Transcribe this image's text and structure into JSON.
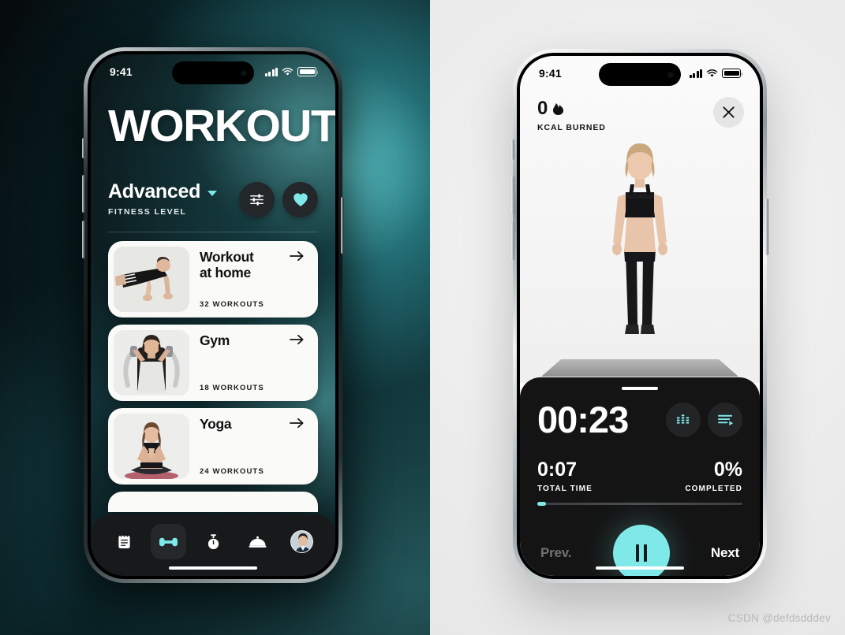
{
  "watermark": "CSDN @defdsdddev",
  "left_phone": {
    "status_bar": {
      "time": "9:41",
      "cellular_icon": "cellular-bars-icon",
      "wifi_icon": "wifi-icon",
      "battery_icon": "battery-icon"
    },
    "title": "WORKOUT",
    "level": {
      "value": "Advanced",
      "label": "FITNESS LEVEL",
      "chevron_icon": "chevron-down-icon"
    },
    "actions": [
      {
        "name": "filter-button",
        "icon": "sliders-icon",
        "color": "#ffffff"
      },
      {
        "name": "favorites-button",
        "icon": "heart-icon",
        "color": "#7fe9ea"
      }
    ],
    "cards": [
      {
        "title": "Workout\nat home",
        "meta": "32 WORKOUTS",
        "thumb": "pushup-photo",
        "arrow_icon": "arrow-right-icon"
      },
      {
        "title": "Gym",
        "meta": "18 WORKOUTS",
        "thumb": "gym-machine-photo",
        "arrow_icon": "arrow-right-icon"
      },
      {
        "title": "Yoga",
        "meta": "24 WORKOUTS",
        "thumb": "yoga-pose-photo",
        "arrow_icon": "arrow-right-icon"
      }
    ],
    "tabs": [
      {
        "name": "tab-plan",
        "icon": "notepad-icon",
        "active": false
      },
      {
        "name": "tab-workout",
        "icon": "dumbbell-icon",
        "active": true
      },
      {
        "name": "tab-timer",
        "icon": "stopwatch-icon",
        "active": false
      },
      {
        "name": "tab-nutrition",
        "icon": "food-dome-icon",
        "active": false
      },
      {
        "name": "tab-profile",
        "icon": "avatar-icon",
        "active": false
      }
    ]
  },
  "right_phone": {
    "status_bar": {
      "time": "9:41",
      "cellular_icon": "cellular-bars-icon",
      "wifi_icon": "wifi-icon",
      "battery_icon": "battery-icon"
    },
    "kcal": {
      "value": "0",
      "flame_icon": "flame-icon",
      "label": "KCAL BURNED"
    },
    "close_icon": "close-icon",
    "exercise_image": "standing-athlete-photo",
    "timer": {
      "current": "00:23"
    },
    "timer_buttons": [
      {
        "name": "intensity-button",
        "icon": "equalizer-icon"
      },
      {
        "name": "playlist-button",
        "icon": "queue-list-icon"
      }
    ],
    "stats": [
      {
        "value": "0:07",
        "label": "TOTAL TIME"
      },
      {
        "value": "0%",
        "label": "COMPLETED"
      }
    ],
    "progress_percent": 3,
    "controls": {
      "prev": "Prev.",
      "next": "Next",
      "play_icon": "pause-icon"
    }
  },
  "colors": {
    "accent": "#7fe9ea",
    "sheet_bg": "#141414",
    "card_bg": "#fafaf8"
  }
}
